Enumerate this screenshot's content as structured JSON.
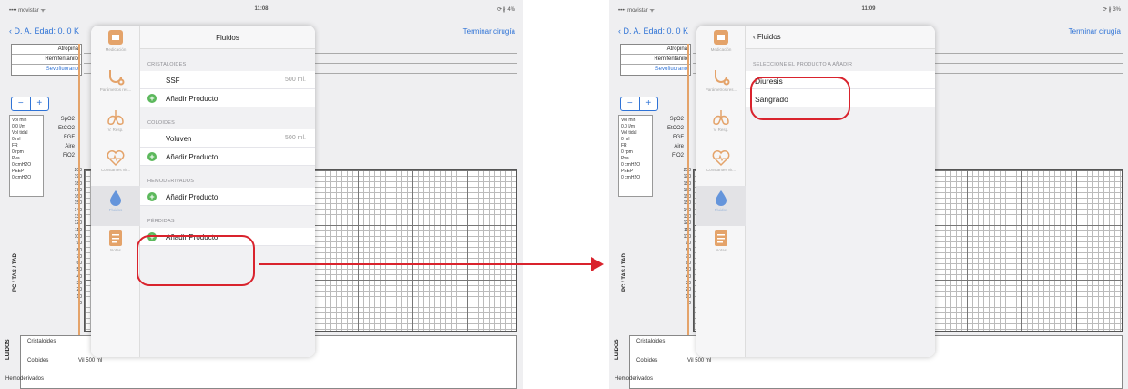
{
  "status": {
    "carrier_left": "•••• movistar ᯤ",
    "time_left": "11:08",
    "battery_left": "⟳ ∦ 4%",
    "carrier_right": "•••• movistar ᯤ",
    "time_right": "11:09",
    "battery_right": "⟳ ∦ 3%"
  },
  "nav": {
    "back_label": "D. A. Edad: 0. 0 K",
    "finish_label": "Terminar cirugía"
  },
  "drugs": [
    "Atropina",
    "Remifentanilo",
    "Sevofluorano"
  ],
  "stepper": {
    "minus": "−",
    "plus": "+"
  },
  "vitals_box": [
    "Vol min",
    "0.0 l/m",
    "Vol tidal",
    "0 ml",
    "FR",
    "0 rpm",
    "Pva",
    "0 cmH2O",
    "PEEP",
    "0 cmH2O"
  ],
  "vitals_labels": [
    "SpO2",
    "EtCO2",
    "FGF",
    "Aire",
    "FiO2"
  ],
  "scale": [
    "200",
    "190",
    "180",
    "170",
    "160",
    "150",
    "140",
    "130",
    "120",
    "110",
    "100",
    "90",
    "80",
    "70",
    "60",
    "50",
    "40",
    "30",
    "20",
    "10",
    "0"
  ],
  "y_axis_label": "PC / TAS / TAD",
  "fluid_rows": [
    "Cristaloides",
    "Coloides",
    "Hemoderivados"
  ],
  "fluid_side": "LUIDOS",
  "fluid_value": "Vil 500 ml",
  "tabs": [
    {
      "label": "Medicación",
      "icon": "medication-icon"
    },
    {
      "label": "Parámetros res...",
      "icon": "stethoscope-icon"
    },
    {
      "label": "V. Resp.",
      "icon": "lungs-icon"
    },
    {
      "label": "Constantes vit...",
      "icon": "heart-monitor-icon"
    },
    {
      "label": "Fluidos",
      "icon": "drop-icon"
    },
    {
      "label": "Notas",
      "icon": "notes-icon"
    }
  ],
  "left_panel": {
    "title": "Fluidos",
    "sections": [
      {
        "header": "CRISTALOIDES",
        "product": "SSF",
        "qty": "500 ml.",
        "add": "Añadir Producto"
      },
      {
        "header": "COLOIDES",
        "product": "Voluven",
        "qty": "500 ml.",
        "add": "Añadir Producto"
      },
      {
        "header": "HEMODERIVADOS",
        "add": "Añadir Producto"
      },
      {
        "header": "PÉRDIDAS",
        "add": "Añadir Producto"
      }
    ]
  },
  "right_panel": {
    "back_label": "Fluidos",
    "section": "SELECCIONE EL PRODUCTO A AÑADIR",
    "options": [
      "Diuresis",
      "Sangrado"
    ]
  },
  "colors": {
    "accent": "#2f73d6",
    "highlight": "#d9232d",
    "add_green": "#5cb85c",
    "tab_orange": "#e4a36a"
  }
}
